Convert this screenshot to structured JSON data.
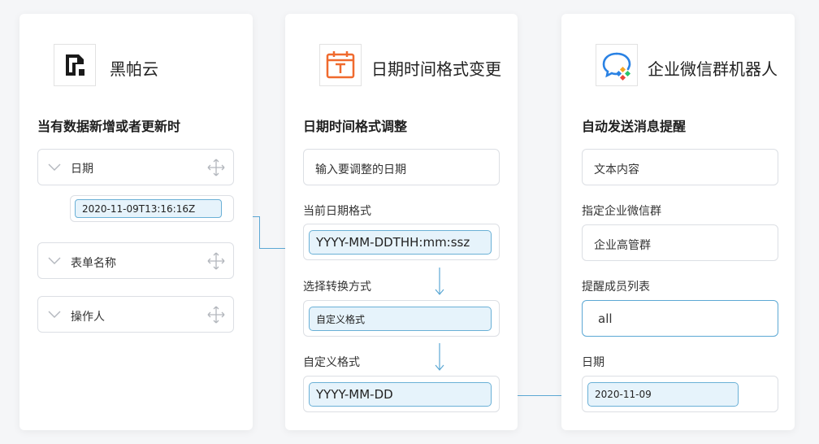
{
  "trigger": {
    "app_name": "黑帕云",
    "title": "当有数据新增或者更新时",
    "fields": [
      {
        "label": "日期",
        "value": "2020-11-09T13:16:16Z"
      },
      {
        "label": "表单名称"
      },
      {
        "label": "操作人"
      }
    ]
  },
  "transform": {
    "app_name": "日期时间格式变更",
    "title": "日期时间格式调整",
    "date_input_placeholder": "输入要调整的日期",
    "current_format_label": "当前日期格式",
    "current_format_value": "YYYY-MM-DDTHH:mm:ssz",
    "convert_method_label": "选择转换方式",
    "convert_method_value": "自定义格式",
    "custom_format_label": "自定义格式",
    "custom_format_value": "YYYY-MM-DD"
  },
  "action": {
    "app_name": "企业微信群机器人",
    "title": "自动发送消息提醒",
    "text_content_placeholder": "文本内容",
    "group_label": "指定企业微信群",
    "group_value": "企业高管群",
    "mention_label": "提醒成员列表",
    "mention_value": "all",
    "date_label": "日期",
    "date_value": "2020-11-09"
  },
  "colors": {
    "accent": "#5ca8d4",
    "chip_bg": "#e6f3fb",
    "calendar_icon": "#f06a2e",
    "wecom_blue": "#2a82e4"
  }
}
